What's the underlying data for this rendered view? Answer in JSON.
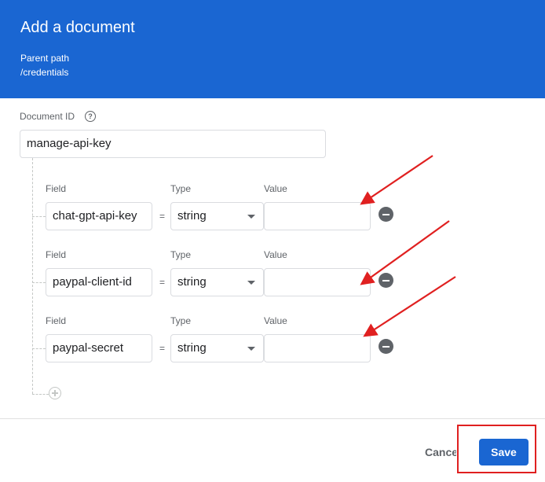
{
  "header": {
    "title": "Add a document",
    "parent_path_label": "Parent path",
    "parent_path_value": "/credentials"
  },
  "document_id": {
    "label": "Document ID",
    "value": "manage-api-key"
  },
  "field_headers": {
    "field": "Field",
    "type": "Type",
    "value": "Value"
  },
  "fields": [
    {
      "name": "chat-gpt-api-key",
      "equals": "=",
      "type": "string",
      "value": ""
    },
    {
      "name": "paypal-client-id",
      "equals": "=",
      "type": "string",
      "value": ""
    },
    {
      "name": "paypal-secret",
      "equals": "=",
      "type": "string",
      "value": ""
    }
  ],
  "footer": {
    "cancel_label": "Cancel",
    "save_label": "Save"
  },
  "colors": {
    "header_bg": "#1a66d2",
    "annotation": "#e02020"
  }
}
